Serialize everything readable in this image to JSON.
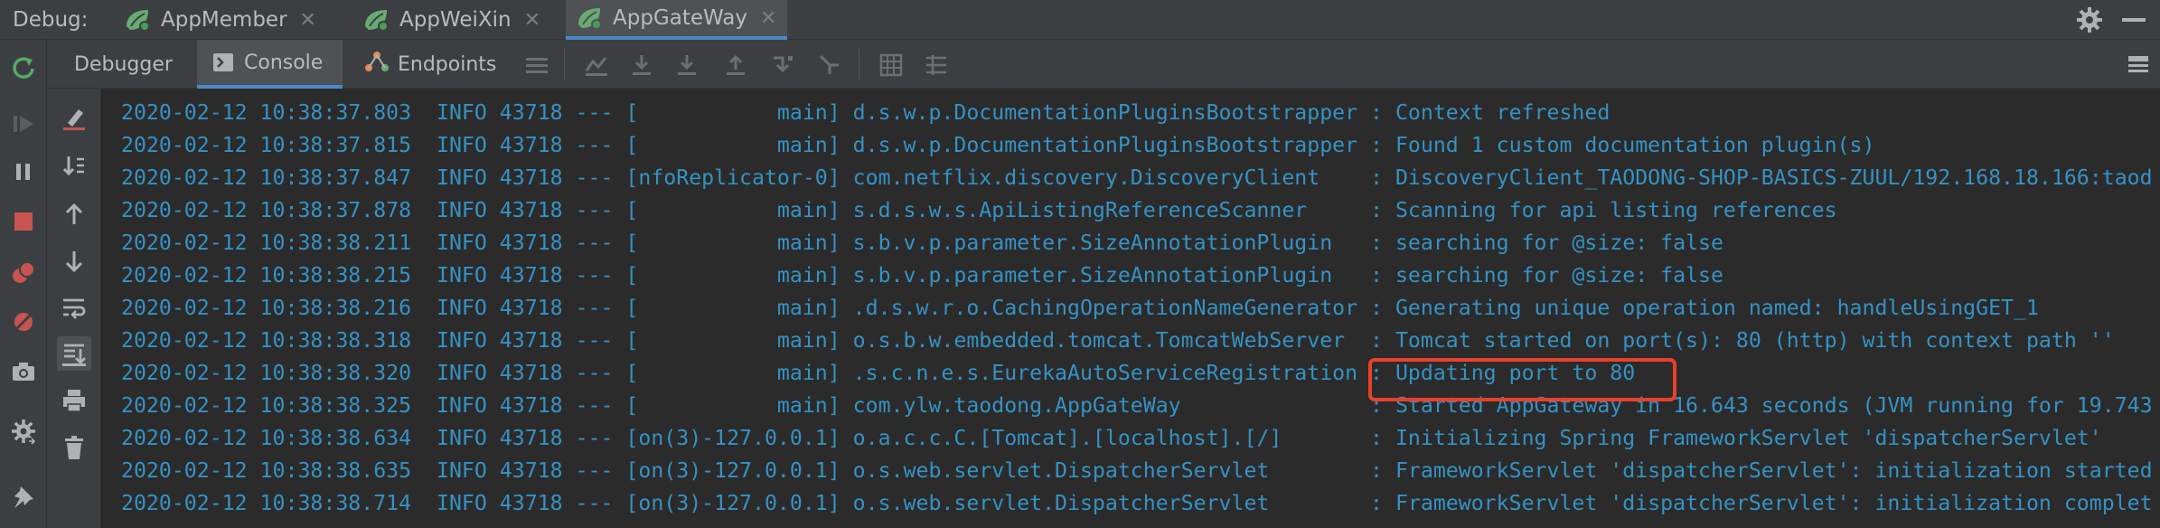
{
  "debug_label": "Debug:",
  "run_tabs": [
    {
      "label": "AppMember",
      "active": false
    },
    {
      "label": "AppWeiXin",
      "active": false
    },
    {
      "label": "AppGateWay",
      "active": true
    }
  ],
  "sub_tabs": {
    "debugger": "Debugger",
    "console": "Console",
    "endpoints": "Endpoints"
  },
  "colors": {
    "log_text": "#3592c4",
    "highlight": "#e8412b",
    "accent": "#4a88c7",
    "spring_green": "#6aab73"
  },
  "log_lines": [
    "2020-02-12 10:38:37.803  INFO 43718 --- [           main] d.s.w.p.DocumentationPluginsBootstrapper : Context refreshed",
    "2020-02-12 10:38:37.815  INFO 43718 --- [           main] d.s.w.p.DocumentationPluginsBootstrapper : Found 1 custom documentation plugin(s)",
    "2020-02-12 10:38:37.847  INFO 43718 --- [nfoReplicator-0] com.netflix.discovery.DiscoveryClient    : DiscoveryClient_TAODONG-SHOP-BASICS-ZUUL/192.168.18.166:taod",
    "2020-02-12 10:38:37.878  INFO 43718 --- [           main] s.d.s.w.s.ApiListingReferenceScanner     : Scanning for api listing references",
    "2020-02-12 10:38:38.211  INFO 43718 --- [           main] s.b.v.p.parameter.SizeAnnotationPlugin   : searching for @size: false",
    "2020-02-12 10:38:38.215  INFO 43718 --- [           main] s.b.v.p.parameter.SizeAnnotationPlugin   : searching for @size: false",
    "2020-02-12 10:38:38.216  INFO 43718 --- [           main] .d.s.w.r.o.CachingOperationNameGenerator : Generating unique operation named: handleUsingGET_1",
    "2020-02-12 10:38:38.318  INFO 43718 --- [           main] o.s.b.w.embedded.tomcat.TomcatWebServer  : Tomcat started on port(s): 80 (http) with context path ''",
    "2020-02-12 10:38:38.320  INFO 43718 --- [           main] .s.c.n.e.s.EurekaAutoServiceRegistration : Updating port to 80",
    "2020-02-12 10:38:38.325  INFO 43718 --- [           main] com.ylw.taodong.AppGateWay               : Started AppGateway in 16.643 seconds (JVM running for 19.743",
    "2020-02-12 10:38:38.634  INFO 43718 --- [on(3)-127.0.0.1] o.a.c.c.C.[Tomcat].[localhost].[/]       : Initializing Spring FrameworkServlet 'dispatcherServlet'",
    "2020-02-12 10:38:38.635  INFO 43718 --- [on(3)-127.0.0.1] o.s.web.servlet.DispatcherServlet        : FrameworkServlet 'dispatcherServlet': initialization started",
    "2020-02-12 10:38:38.714  INFO 43718 --- [on(3)-127.0.0.1] o.s.web.servlet.DispatcherServlet        : FrameworkServlet 'dispatcherServlet': initialization complet"
  ],
  "icons": {
    "top": [
      "spring-boot-icon",
      "close-icon",
      "gear-icon",
      "minimize-icon"
    ],
    "left_outer": [
      "rerun-icon",
      "resume-icon",
      "pause-icon",
      "stop-icon",
      "view-breakpoints-icon",
      "mute-breakpoints-icon",
      "camera-icon",
      "settings-icon",
      "pin-icon"
    ],
    "left_inner": [
      "clear-console-icon",
      "scroll-to-end-icon",
      "up-arrow-icon",
      "down-arrow-icon",
      "soft-wrap-icon",
      "scroll-to-end-active-icon",
      "print-icon",
      "trash-icon"
    ]
  }
}
